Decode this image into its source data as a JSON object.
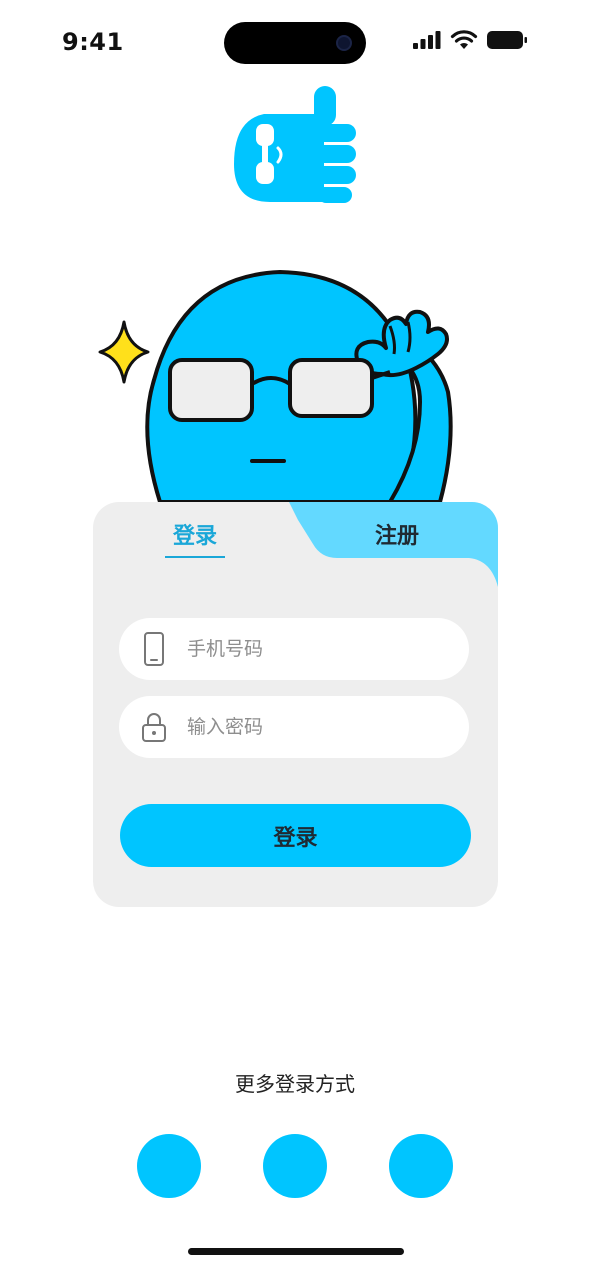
{
  "status_bar": {
    "time": "9:41",
    "icons": [
      "signal-icon",
      "wifi-icon",
      "battery-icon"
    ]
  },
  "brand": {
    "logo_icon": "thumbs-up-logo-icon",
    "mascot": "glasses-mascot-illustration"
  },
  "colors": {
    "accent": "#00c5ff",
    "tab_active_text": "#1aa7d8",
    "tab_inactive_bg": "#63d9ff",
    "card_bg": "#eeeeee",
    "sparkle": "#ffe01b"
  },
  "tabs": {
    "login_label": "登录",
    "register_label": "注册",
    "active": "login"
  },
  "form": {
    "phone": {
      "placeholder": "手机号码",
      "value": "",
      "icon": "phone-icon"
    },
    "password": {
      "placeholder": "输入密码",
      "value": "",
      "icon": "lock-icon"
    },
    "submit_label": "登录"
  },
  "more_login": {
    "title": "更多登录方式",
    "options": [
      "social-login-option-1",
      "social-login-option-2",
      "social-login-option-3"
    ]
  }
}
